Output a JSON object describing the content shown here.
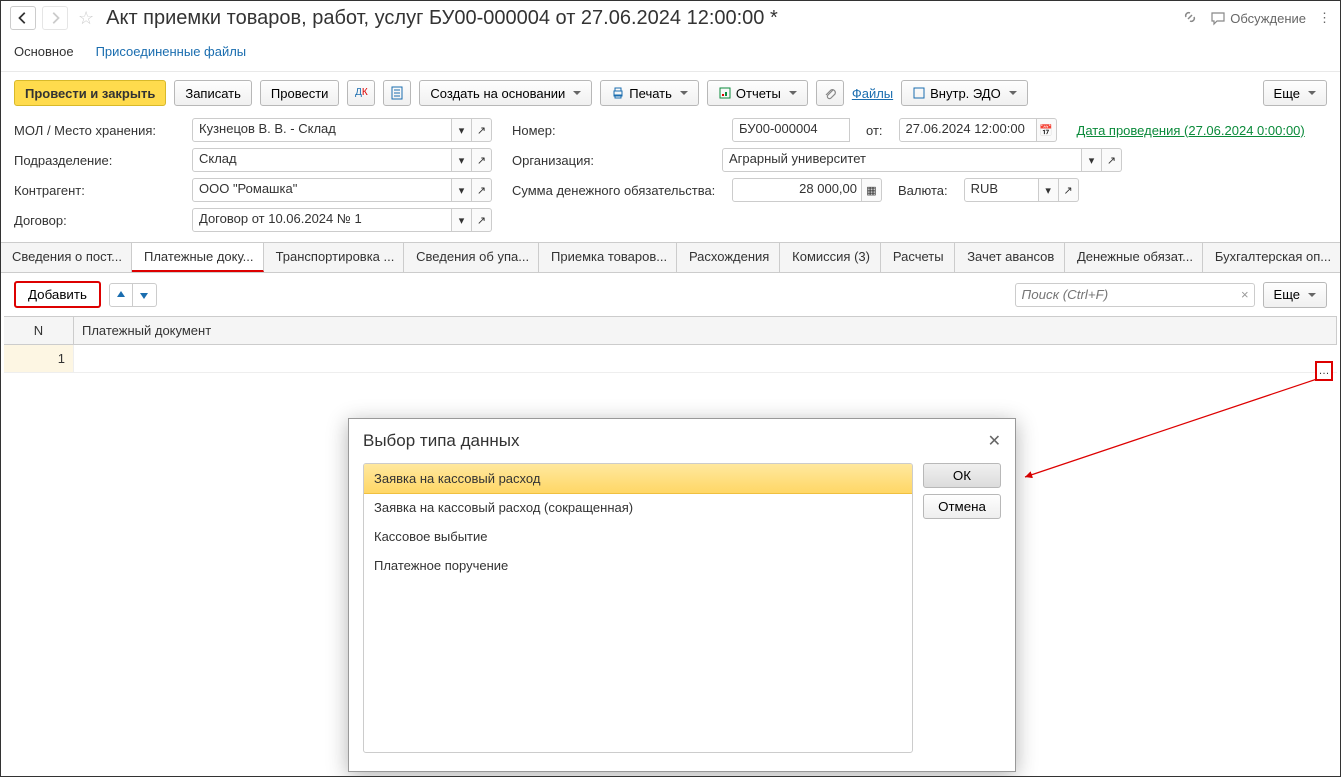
{
  "header": {
    "title": "Акт приемки товаров, работ, услуг БУ00-000004 от 27.06.2024 12:00:00 *",
    "discussion": "Обсуждение"
  },
  "topTabs": {
    "main": "Основное",
    "files": "Присоединенные файлы"
  },
  "toolbar": {
    "postAndClose": "Провести и закрыть",
    "save": "Записать",
    "post": "Провести",
    "createBasedOn": "Создать на основании",
    "print": "Печать",
    "reports": "Отчеты",
    "files": "Файлы",
    "edo": "Внутр. ЭДО",
    "more": "Еще"
  },
  "form": {
    "molLabel": "МОЛ / Место хранения:",
    "molValue": "Кузнецов В. В. - Склад",
    "numberLabel": "Номер:",
    "numberValue": "БУ00-000004",
    "fromLabel": "от:",
    "dateValue": "27.06.2024 12:00:00",
    "postDateLink": "Дата проведения (27.06.2024 0:00:00)",
    "deptLabel": "Подразделение:",
    "deptValue": "Склад",
    "orgLabel": "Организация:",
    "orgValue": "Аграрный университет",
    "counterpartyLabel": "Контрагент:",
    "counterpartyValue": "ООО \"Ромашка\"",
    "sumLabel": "Сумма денежного обязательства:",
    "sumValue": "28 000,00",
    "currencyLabel": "Валюта:",
    "currencyValue": "RUB",
    "contractLabel": "Договор:",
    "contractValue": "Договор от 10.06.2024 № 1"
  },
  "subTabs": {
    "t1": "Сведения о пост...",
    "t2": "Платежные доку...",
    "t3": "Транспортировка ...",
    "t4": "Сведения об упа...",
    "t5": "Приемка товаров...",
    "t6": "Расхождения",
    "t7": "Комиссия (3)",
    "t8": "Расчеты",
    "t9": "Зачет авансов",
    "t10": "Денежные обязат...",
    "t11": "Бухгалтерская оп..."
  },
  "tableToolbar": {
    "add": "Добавить",
    "searchPlaceholder": "Поиск (Ctrl+F)",
    "more": "Еще"
  },
  "table": {
    "colN": "N",
    "colDoc": "Платежный документ",
    "rows": [
      {
        "n": "1"
      }
    ]
  },
  "dialog": {
    "title": "Выбор типа данных",
    "ok": "ОК",
    "cancel": "Отмена",
    "options": [
      "Заявка на кассовый расход",
      "Заявка на кассовый расход (сокращенная)",
      "Кассовое выбытие",
      "Платежное поручение"
    ]
  }
}
